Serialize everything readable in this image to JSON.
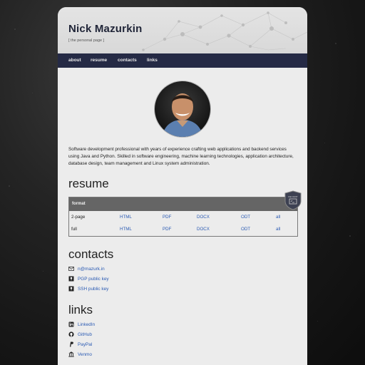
{
  "site": {
    "title": "Nick Mazurkin",
    "subtitle": "[ the personal page ]"
  },
  "nav": [
    {
      "label": "about"
    },
    {
      "label": "resume"
    },
    {
      "label": "contacts"
    },
    {
      "label": "links"
    }
  ],
  "about": {
    "bio": "Software development professional with years of experience crafting web applications and backend services using Java and Python. Skilled in software engineering, machine learning technologies, application architecture, database design, team management and Linux system administration."
  },
  "resume": {
    "heading": "resume",
    "header_label": "format",
    "badge_text": "DE NANT",
    "rows": [
      {
        "label": "2-page",
        "formats": [
          "HTML",
          "PDF",
          "DOCX",
          "ODT",
          "all"
        ]
      },
      {
        "label": "full",
        "formats": [
          "HTML",
          "PDF",
          "DOCX",
          "ODT",
          "all"
        ]
      }
    ]
  },
  "contacts": {
    "heading": "contacts",
    "items": [
      {
        "label": "n@mazurk.in",
        "icon": "email-icon"
      },
      {
        "label": "PGP public key",
        "icon": "key-icon"
      },
      {
        "label": "SSH public key",
        "icon": "key-icon"
      }
    ]
  },
  "links": {
    "heading": "links",
    "items": [
      {
        "label": "LinkedIn",
        "icon": "linkedin-icon"
      },
      {
        "label": "GitHub",
        "icon": "github-icon"
      },
      {
        "label": "PayPal",
        "icon": "paypal-icon"
      },
      {
        "label": "Venmo",
        "icon": "bank-icon"
      }
    ]
  },
  "colors": {
    "nav_bg": "#252a45",
    "link": "#2a5ab3",
    "table_header": "#656565"
  }
}
